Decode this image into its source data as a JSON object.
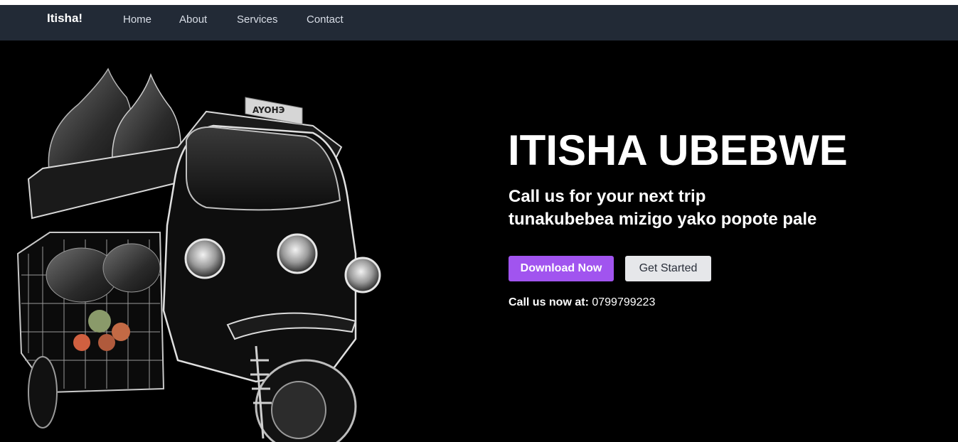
{
  "navbar": {
    "brand": "Itisha!",
    "links": [
      "Home",
      "About",
      "Services",
      "Contact"
    ],
    "background": "#222a36"
  },
  "hero": {
    "title": "ITISHA UBEBWE",
    "subtitle_line1": "Call us for your next trip",
    "subtitle_line2": "tunakubebea mizigo yako popote pale",
    "primary_button": "Download Now",
    "secondary_button": "Get Started",
    "phone_label": "Call us now at:",
    "phone_number": "0799799223",
    "image_sign_text": "AYOHЭ",
    "accent_color": "#a154ef",
    "image_subject": "black-and-white cargo tuk-tuk loaded with bags"
  }
}
